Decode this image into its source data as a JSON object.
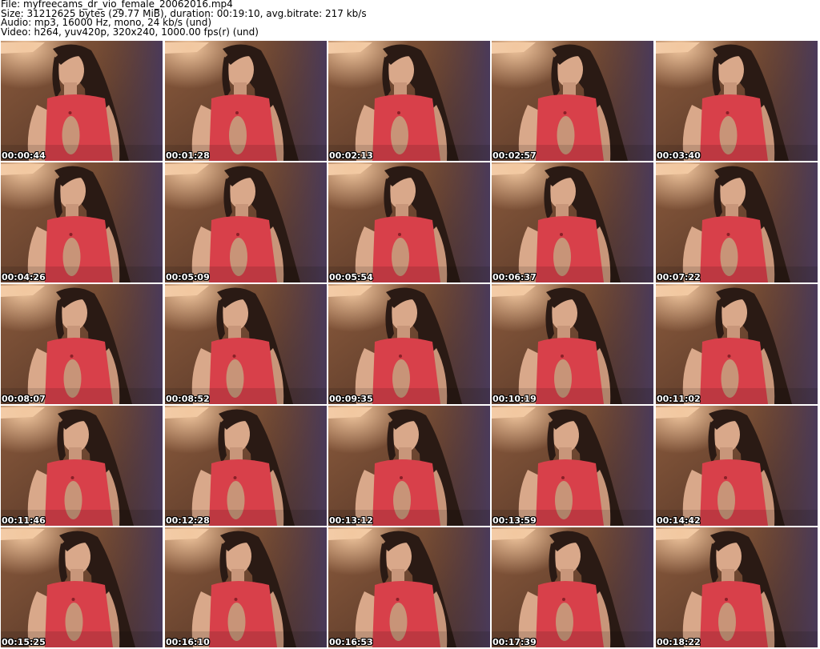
{
  "header": {
    "file_line": "File: myfreecams_dr_vio_female_20062016.mp4",
    "size_line": "Size: 31212625 bytes (29.77 MiB), duration: 00:19:10, avg.bitrate: 217 kb/s",
    "audio_line": "Audio: mp3, 16000 Hz, mono, 24 kb/s (und)",
    "video_line": "Video: h264, yuv420p, 320x240, 1000.00 fps(r) (und)"
  },
  "thumbnails": [
    {
      "timestamp": "00:00:44"
    },
    {
      "timestamp": "00:01:28"
    },
    {
      "timestamp": "00:02:13"
    },
    {
      "timestamp": "00:02:57"
    },
    {
      "timestamp": "00:03:40"
    },
    {
      "timestamp": "00:04:26"
    },
    {
      "timestamp": "00:05:09"
    },
    {
      "timestamp": "00:05:54"
    },
    {
      "timestamp": "00:06:37"
    },
    {
      "timestamp": "00:07:22"
    },
    {
      "timestamp": "00:08:07"
    },
    {
      "timestamp": "00:08:52"
    },
    {
      "timestamp": "00:09:35"
    },
    {
      "timestamp": "00:10:19"
    },
    {
      "timestamp": "00:11:02"
    },
    {
      "timestamp": "00:11:46"
    },
    {
      "timestamp": "00:12:28"
    },
    {
      "timestamp": "00:13:12"
    },
    {
      "timestamp": "00:13:59"
    },
    {
      "timestamp": "00:14:42"
    },
    {
      "timestamp": "00:15:25"
    },
    {
      "timestamp": "00:16:10"
    },
    {
      "timestamp": "00:16:53"
    },
    {
      "timestamp": "00:17:39"
    },
    {
      "timestamp": "00:18:22"
    }
  ],
  "colors": {
    "background": "#ffffff",
    "wall": "#6b4530",
    "dress": "#d8404a",
    "hair": "#2a1a14",
    "skin": "#d9a88a",
    "lamp": "#f2c8a0"
  }
}
